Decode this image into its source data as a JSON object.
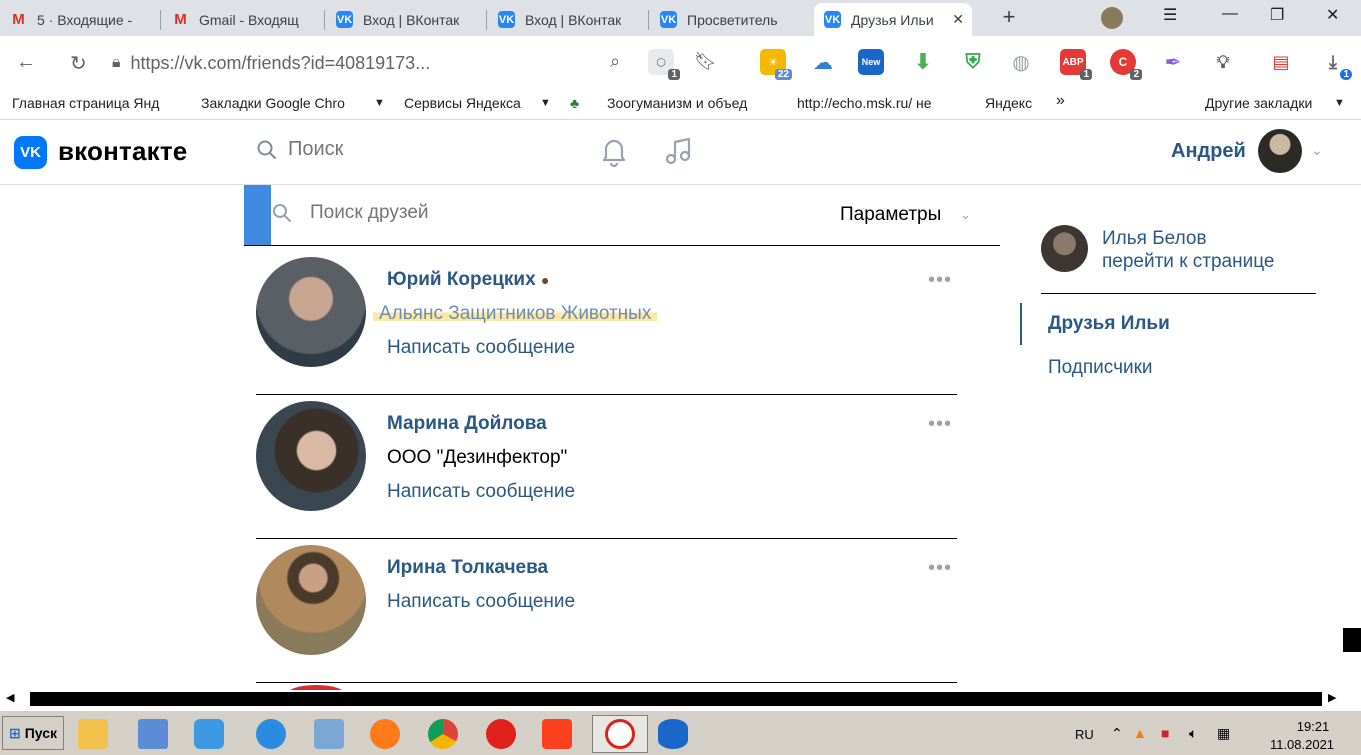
{
  "browser": {
    "tabs": [
      {
        "label": "5 · Входящие -",
        "icon": "mail-icon"
      },
      {
        "label": "Gmail - Входящ",
        "icon": "gmail-icon"
      },
      {
        "label": "Вход | ВКонтак",
        "icon": "vk-icon"
      },
      {
        "label": "Вход | ВКонтак",
        "icon": "vk-icon"
      },
      {
        "label": "Просветитель",
        "icon": "vk-icon"
      },
      {
        "label": "Друзья Ильи",
        "icon": "vk-icon",
        "active": true
      }
    ],
    "new_tab_symbol": "+",
    "url": "https://vk.com/friends?id=40819173...",
    "extension_badges": {
      "weather": "22",
      "new": "New",
      "ext1": "1",
      "abp": "1",
      "ext2": "2",
      "download": "1"
    },
    "bookmarks": [
      "Главная страница Янд",
      "Закладки Google Chro",
      "Сервисы Яндекса",
      "Зоогуманизм и объед",
      "http://echo.msk.ru/ не",
      "Яндекс",
      "Другие закладки"
    ]
  },
  "vk": {
    "brand": "вконтакте",
    "search_placeholder": "Поиск",
    "user_name": "Андрей",
    "friend_search_placeholder": "Поиск друзей",
    "params_label": "Параметры",
    "friends": [
      {
        "name": "Юрий Корецких",
        "subtitle": "Альянс Защитников Животных",
        "message": "Написать сообщение",
        "avatar_color": "#6b7480"
      },
      {
        "name": "Марина Дойлова",
        "subtitle": "ООО \"Дезинфектор\"",
        "message": "Написать сообщение",
        "avatar_color": "#3a4650"
      },
      {
        "name": "Ирина Толкачева",
        "subtitle": "",
        "message": "Написать сообщение",
        "avatar_color": "#8a7a5c"
      }
    ],
    "side": {
      "owner_name": "Илья Белов",
      "owner_link": "перейти к странице",
      "nav_friends": "Друзья Ильи",
      "nav_subscribers": "Подписчики"
    }
  },
  "taskbar": {
    "start_label": "Пуск",
    "lang": "RU",
    "time": "19:21",
    "date": "11.08.2021"
  },
  "colors": {
    "vk_blue": "#0077ff",
    "link_blue": "#2a5885",
    "highlight": "#fce7a3"
  }
}
